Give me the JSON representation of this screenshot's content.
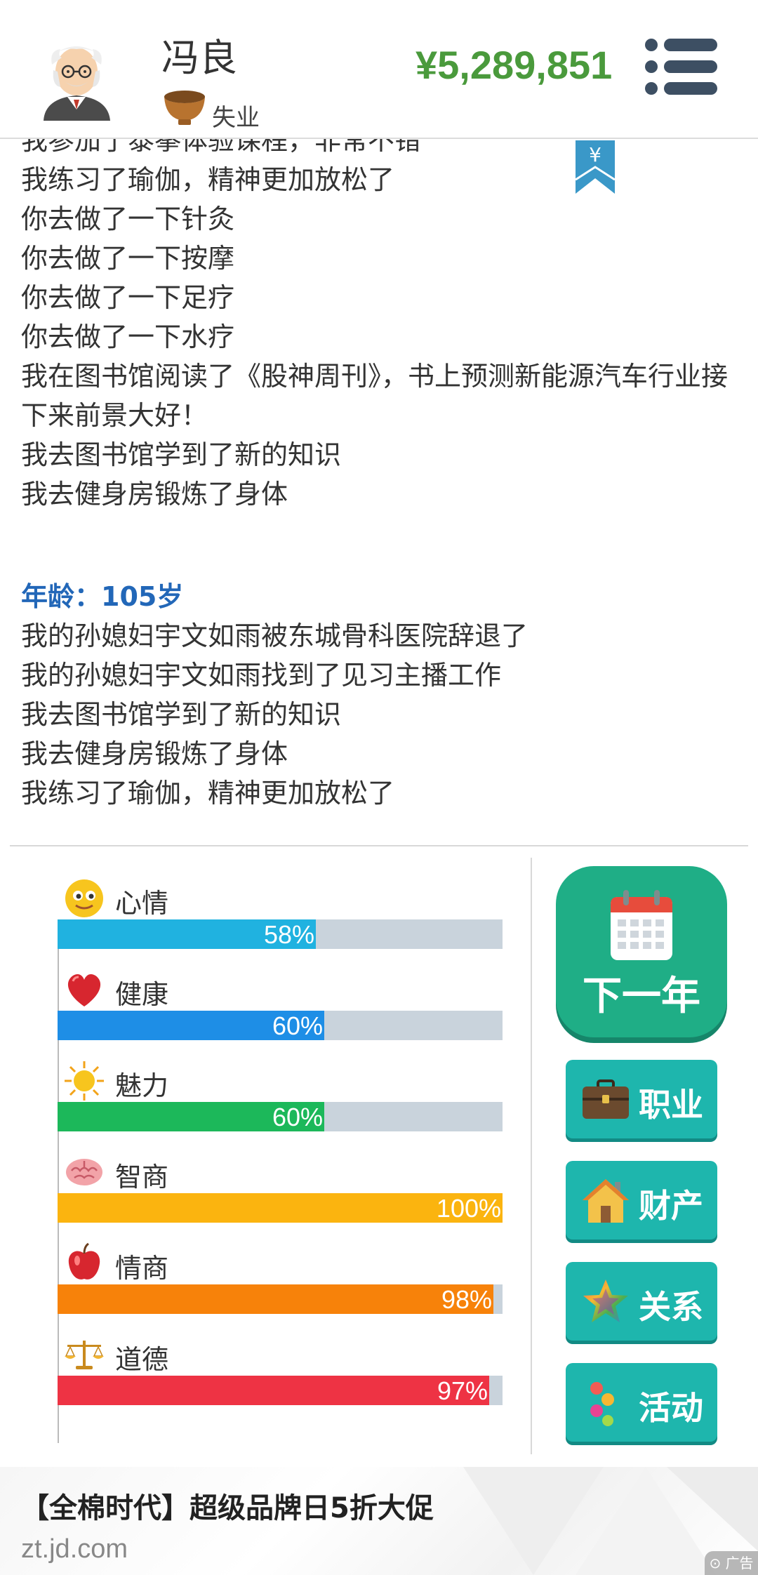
{
  "header": {
    "player_name": "冯良",
    "job": "失业",
    "money": "¥5,289,851"
  },
  "log": {
    "lines_before": [
      "我参加了泰拳体验课程，非常不错",
      "我练习了瑜伽，精神更加放松了",
      "你去做了一下针灸",
      "你去做了一下按摩",
      "你去做了一下足疗",
      "你去做了一下水疗",
      "我在图书馆阅读了《股神周刊》，书上预测新能源汽车行业接下来前景大好！",
      "我去图书馆学到了新的知识",
      "我去健身房锻炼了身体"
    ],
    "age_heading": "年龄：105岁",
    "lines_after": [
      "我的孙媳妇宇文如雨被东城骨科医院辞退了",
      "我的孙媳妇宇文如雨找到了见习主播工作",
      "我去图书馆学到了新的知识",
      "我去健身房锻炼了身体",
      "我练习了瑜伽，精神更加放松了"
    ],
    "bookmark_symbol": "¥"
  },
  "stats": [
    {
      "label": "心情",
      "percent_text": "58%",
      "value": 58,
      "color": "#20b2e0",
      "icon": "smiley-face-icon"
    },
    {
      "label": "健康",
      "percent_text": "60%",
      "value": 60,
      "color": "#1e8ee6",
      "icon": "heart-icon"
    },
    {
      "label": "魅力",
      "percent_text": "60%",
      "value": 60,
      "color": "#1cb85a",
      "icon": "sun-icon"
    },
    {
      "label": "智商",
      "percent_text": "100%",
      "value": 100,
      "color": "#fbb40f",
      "icon": "brain-icon"
    },
    {
      "label": "情商",
      "percent_text": "98%",
      "value": 98,
      "color": "#f7820a",
      "icon": "apple-icon"
    },
    {
      "label": "道德",
      "percent_text": "97%",
      "value": 97,
      "color": "#ee3344",
      "icon": "scales-icon"
    }
  ],
  "actions": {
    "next_year": "下一年",
    "career": "职业",
    "property": "财产",
    "relations": "关系",
    "activities": "活动"
  },
  "ad": {
    "title": "【全棉时代】超级品牌日5折大促",
    "url": "zt.jd.com",
    "badge": "广告"
  },
  "colors": {
    "money": "#4a9a3c",
    "age_heading": "#2267b8",
    "next_button": "#1fae86",
    "side_button": "#1eb6ad",
    "bar_track": "#c9d3dc"
  }
}
